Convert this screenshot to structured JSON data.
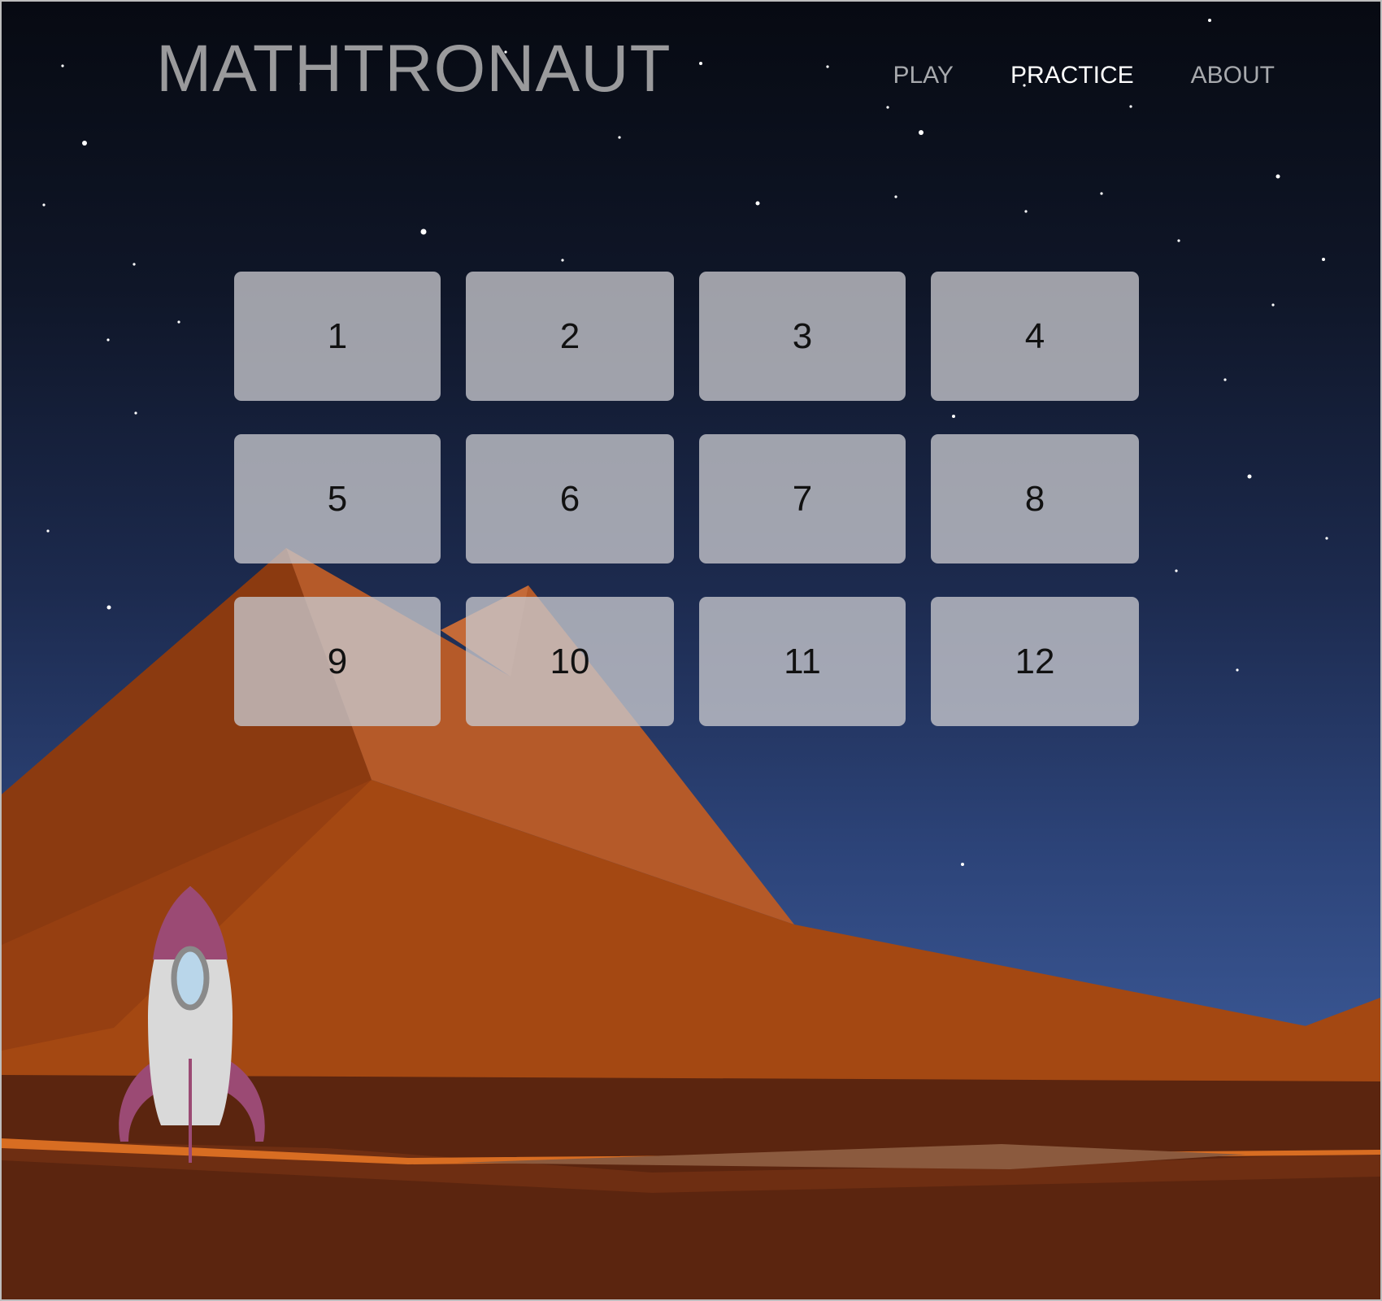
{
  "app": {
    "title": "MATHTRONAUT"
  },
  "nav": {
    "items": [
      {
        "label": "PLAY",
        "active": false
      },
      {
        "label": "PRACTICE",
        "active": true
      },
      {
        "label": "ABOUT",
        "active": false
      }
    ]
  },
  "levels": [
    "1",
    "2",
    "3",
    "4",
    "5",
    "6",
    "7",
    "8",
    "9",
    "10",
    "11",
    "12"
  ],
  "colors": {
    "sky_top": "#070a12",
    "sky_bottom": "#4a67a4",
    "mountain": "#a44812",
    "ground": "#5b250f",
    "rocket_body": "#d9d9d9",
    "rocket_accent": "#9b4a74",
    "window": "#b9d6ea",
    "tile": "#c8c8cd",
    "nav_active": "#ffffff",
    "nav_inactive": "#a7a9ad"
  }
}
